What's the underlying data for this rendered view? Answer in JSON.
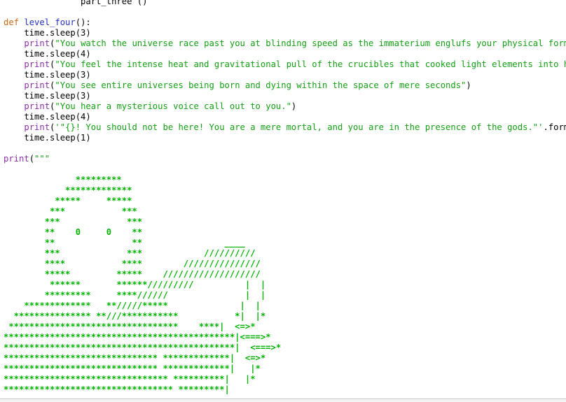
{
  "editor": {
    "code_lines": [
      {
        "segments": [
          {
            "t": "               part_three ()",
            "c": ""
          }
        ]
      },
      {
        "segments": [
          {
            "t": "",
            "c": ""
          }
        ]
      },
      {
        "segments": [
          {
            "t": "def",
            "c": "kw"
          },
          {
            "t": " ",
            "c": ""
          },
          {
            "t": "level_four",
            "c": "fn"
          },
          {
            "t": "():",
            "c": ""
          }
        ]
      },
      {
        "segments": [
          {
            "t": "    time.sleep(3)",
            "c": ""
          }
        ]
      },
      {
        "segments": [
          {
            "t": "    ",
            "c": ""
          },
          {
            "t": "print",
            "c": "bi"
          },
          {
            "t": "(",
            "c": ""
          },
          {
            "t": "\"You watch the universe race past you at blinding speed as the immaterium englufs your physical form.\"",
            "c": "str"
          },
          {
            "t": ")",
            "c": ""
          }
        ]
      },
      {
        "segments": [
          {
            "t": "    time.sleep(4)",
            "c": ""
          }
        ]
      },
      {
        "segments": [
          {
            "t": "    ",
            "c": ""
          },
          {
            "t": "print",
            "c": "bi"
          },
          {
            "t": "(",
            "c": ""
          },
          {
            "t": "\"You feel the intense heat and gravitational pull of the crucibles that cooked light elements into heavy",
            "c": "str"
          }
        ]
      },
      {
        "segments": [
          {
            "t": "    time.sleep(3)",
            "c": ""
          }
        ]
      },
      {
        "segments": [
          {
            "t": "    ",
            "c": ""
          },
          {
            "t": "print",
            "c": "bi"
          },
          {
            "t": "(",
            "c": ""
          },
          {
            "t": "\"You see entire universes being born and dying within the space of mere seconds\"",
            "c": "str"
          },
          {
            "t": ")",
            "c": ""
          }
        ]
      },
      {
        "segments": [
          {
            "t": "    time.sleep(3)",
            "c": ""
          }
        ]
      },
      {
        "segments": [
          {
            "t": "    ",
            "c": ""
          },
          {
            "t": "print",
            "c": "bi"
          },
          {
            "t": "(",
            "c": ""
          },
          {
            "t": "\"You hear a mysterious voice call out to you.\"",
            "c": "str"
          },
          {
            "t": ")",
            "c": ""
          }
        ]
      },
      {
        "segments": [
          {
            "t": "    time.sleep(4)",
            "c": ""
          }
        ]
      },
      {
        "segments": [
          {
            "t": "    ",
            "c": ""
          },
          {
            "t": "print",
            "c": "bi"
          },
          {
            "t": "(",
            "c": ""
          },
          {
            "t": "'\"{}! You should not be here! You are a mere mortal, and you are in the presence of the gods.\"'",
            "c": "str"
          },
          {
            "t": ".format(na",
            "c": ""
          }
        ]
      },
      {
        "segments": [
          {
            "t": "    time.sleep(1)",
            "c": ""
          }
        ]
      },
      {
        "segments": [
          {
            "t": "",
            "c": ""
          }
        ]
      },
      {
        "segments": [
          {
            "t": "print",
            "c": "bi"
          },
          {
            "t": "(",
            "c": ""
          },
          {
            "t": "\"\"\"",
            "c": "str"
          }
        ]
      },
      {
        "segments": [
          {
            "t": "",
            "c": ""
          }
        ]
      },
      {
        "segments": [
          {
            "t": "              *********",
            "c": "art"
          }
        ]
      },
      {
        "segments": [
          {
            "t": "            *************",
            "c": "art"
          }
        ]
      },
      {
        "segments": [
          {
            "t": "          *****     *****",
            "c": "art"
          }
        ]
      },
      {
        "segments": [
          {
            "t": "         ***           ***",
            "c": "art"
          }
        ]
      },
      {
        "segments": [
          {
            "t": "        ***             ***",
            "c": "art"
          }
        ]
      },
      {
        "segments": [
          {
            "t": "        **    0     0    **",
            "c": "art"
          }
        ]
      },
      {
        "segments": [
          {
            "t": "        **               **                ____",
            "c": "art"
          }
        ]
      },
      {
        "segments": [
          {
            "t": "        ***             ***            //////////",
            "c": "art"
          }
        ]
      },
      {
        "segments": [
          {
            "t": "        ****           ****        ///////////////",
            "c": "art"
          }
        ]
      },
      {
        "segments": [
          {
            "t": "        *****         *****    ///////////////////",
            "c": "art"
          }
        ]
      },
      {
        "segments": [
          {
            "t": "         ******       ******/////////          |  |",
            "c": "art"
          }
        ]
      },
      {
        "segments": [
          {
            "t": "        *********     ****//////               |  |",
            "c": "art"
          }
        ]
      },
      {
        "segments": [
          {
            "t": "    *************   **/////*****              |  |",
            "c": "art"
          }
        ]
      },
      {
        "segments": [
          {
            "t": "  *************** **///***********           *|  |*",
            "c": "art"
          }
        ]
      },
      {
        "segments": [
          {
            "t": " *********************************    ****|  <=>*",
            "c": "art"
          }
        ]
      },
      {
        "segments": [
          {
            "t": "*********************************************|<===>*",
            "c": "art"
          }
        ]
      },
      {
        "segments": [
          {
            "t": "*********************************************|  <===>*",
            "c": "art"
          }
        ]
      },
      {
        "segments": [
          {
            "t": "****************************** *************|  <=>*",
            "c": "art"
          }
        ]
      },
      {
        "segments": [
          {
            "t": "****************************** *************|   |*",
            "c": "art"
          }
        ]
      },
      {
        "segments": [
          {
            "t": "******************************** **********|   |*",
            "c": "art"
          }
        ]
      },
      {
        "segments": [
          {
            "t": "********************************* *********|",
            "c": "art"
          }
        ]
      }
    ]
  }
}
